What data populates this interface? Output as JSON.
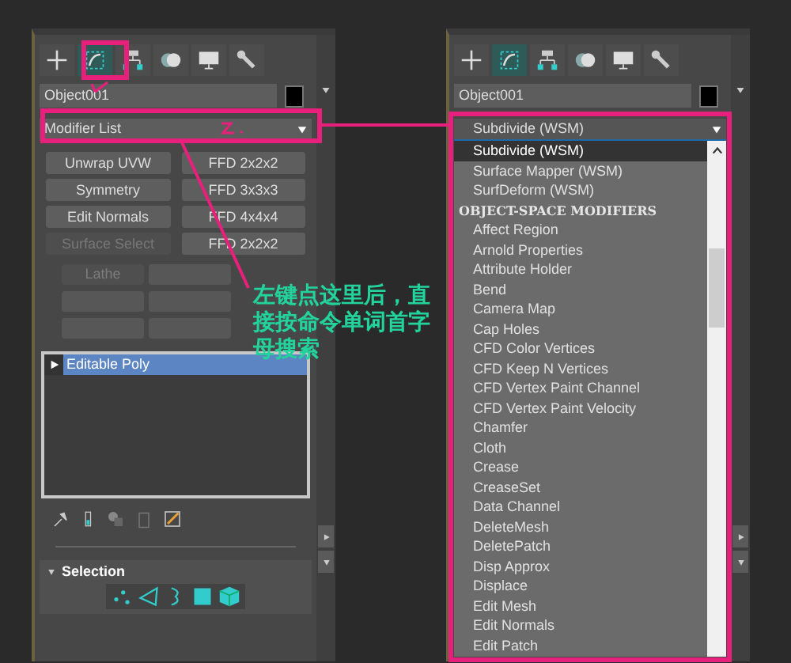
{
  "panels": [
    {
      "tabs": [
        {
          "kind": "create",
          "selected": false
        },
        {
          "kind": "modify",
          "selected": true
        },
        {
          "kind": "hierarchy",
          "selected": false
        },
        {
          "kind": "motion",
          "selected": false
        },
        {
          "kind": "display",
          "selected": false
        },
        {
          "kind": "utilities",
          "selected": false
        }
      ],
      "object_name": "Object001",
      "modifier_dropdown": {
        "value": "Modifier List",
        "expanded": false
      },
      "modifier_buttons": [
        {
          "label": "Unwrap UVW",
          "disabled": false
        },
        {
          "label": "FFD 2x2x2",
          "disabled": false
        },
        {
          "label": "Symmetry",
          "disabled": false
        },
        {
          "label": "FFD 3x3x3",
          "disabled": false
        },
        {
          "label": "Edit Normals",
          "disabled": false
        },
        {
          "label": "FFD 4x4x4",
          "disabled": false
        },
        {
          "label": "Surface Select",
          "disabled": true
        },
        {
          "label": "FFD 2x2x2",
          "disabled": false
        }
      ],
      "small_buttons": [
        {
          "label": "Lathe",
          "disabled": true
        },
        {
          "disabled": false
        },
        {
          "disabled": false
        },
        {
          "disabled": false
        },
        {
          "disabled": false
        },
        {
          "disabled": false
        }
      ],
      "stack": [
        {
          "label": "Editable Poly",
          "selected": true
        }
      ],
      "rollout": {
        "title": "Selection",
        "expanded": true
      }
    },
    {
      "tabs": [
        {
          "kind": "create",
          "selected": false
        },
        {
          "kind": "modify",
          "selected": true
        },
        {
          "kind": "hierarchy",
          "selected": false
        },
        {
          "kind": "motion",
          "selected": false
        },
        {
          "kind": "display",
          "selected": false
        },
        {
          "kind": "utilities",
          "selected": false
        }
      ],
      "object_name": "Object001",
      "modifier_dropdown": {
        "value": "Subdivide (WSM)",
        "expanded": true,
        "items": [
          {
            "kind": "item",
            "label": "Subdivide (WSM)",
            "selected": true
          },
          {
            "kind": "item",
            "label": "Surface Mapper (WSM)",
            "selected": false
          },
          {
            "kind": "item",
            "label": "SurfDeform (WSM)",
            "selected": false
          },
          {
            "kind": "header",
            "label": "OBJECT-SPACE MODIFIERS"
          },
          {
            "kind": "item",
            "label": "Affect Region",
            "selected": false
          },
          {
            "kind": "item",
            "label": "Arnold Properties",
            "selected": false
          },
          {
            "kind": "item",
            "label": "Attribute Holder",
            "selected": false
          },
          {
            "kind": "item",
            "label": "Bend",
            "selected": false
          },
          {
            "kind": "item",
            "label": "Camera Map",
            "selected": false
          },
          {
            "kind": "item",
            "label": "Cap Holes",
            "selected": false
          },
          {
            "kind": "item",
            "label": "CFD Color Vertices",
            "selected": false
          },
          {
            "kind": "item",
            "label": "CFD Keep N Vertices",
            "selected": false
          },
          {
            "kind": "item",
            "label": "CFD Vertex Paint Channel",
            "selected": false
          },
          {
            "kind": "item",
            "label": "CFD Vertex Paint Velocity",
            "selected": false
          },
          {
            "kind": "item",
            "label": "Chamfer",
            "selected": false
          },
          {
            "kind": "item",
            "label": "Cloth",
            "selected": false
          },
          {
            "kind": "item",
            "label": "Crease",
            "selected": false
          },
          {
            "kind": "item",
            "label": "CreaseSet",
            "selected": false
          },
          {
            "kind": "item",
            "label": "Data Channel",
            "selected": false
          },
          {
            "kind": "item",
            "label": "DeleteMesh",
            "selected": false
          },
          {
            "kind": "item",
            "label": "DeletePatch",
            "selected": false
          },
          {
            "kind": "item",
            "label": "Disp Approx",
            "selected": false
          },
          {
            "kind": "item",
            "label": "Displace",
            "selected": false
          },
          {
            "kind": "item",
            "label": "Edit Mesh",
            "selected": false
          },
          {
            "kind": "item",
            "label": "Edit Normals",
            "selected": false
          },
          {
            "kind": "item",
            "label": "Edit Patch",
            "selected": false
          }
        ]
      }
    }
  ],
  "annotation": {
    "note": "左键点这里后，直接按命令单词首字母搜索"
  }
}
